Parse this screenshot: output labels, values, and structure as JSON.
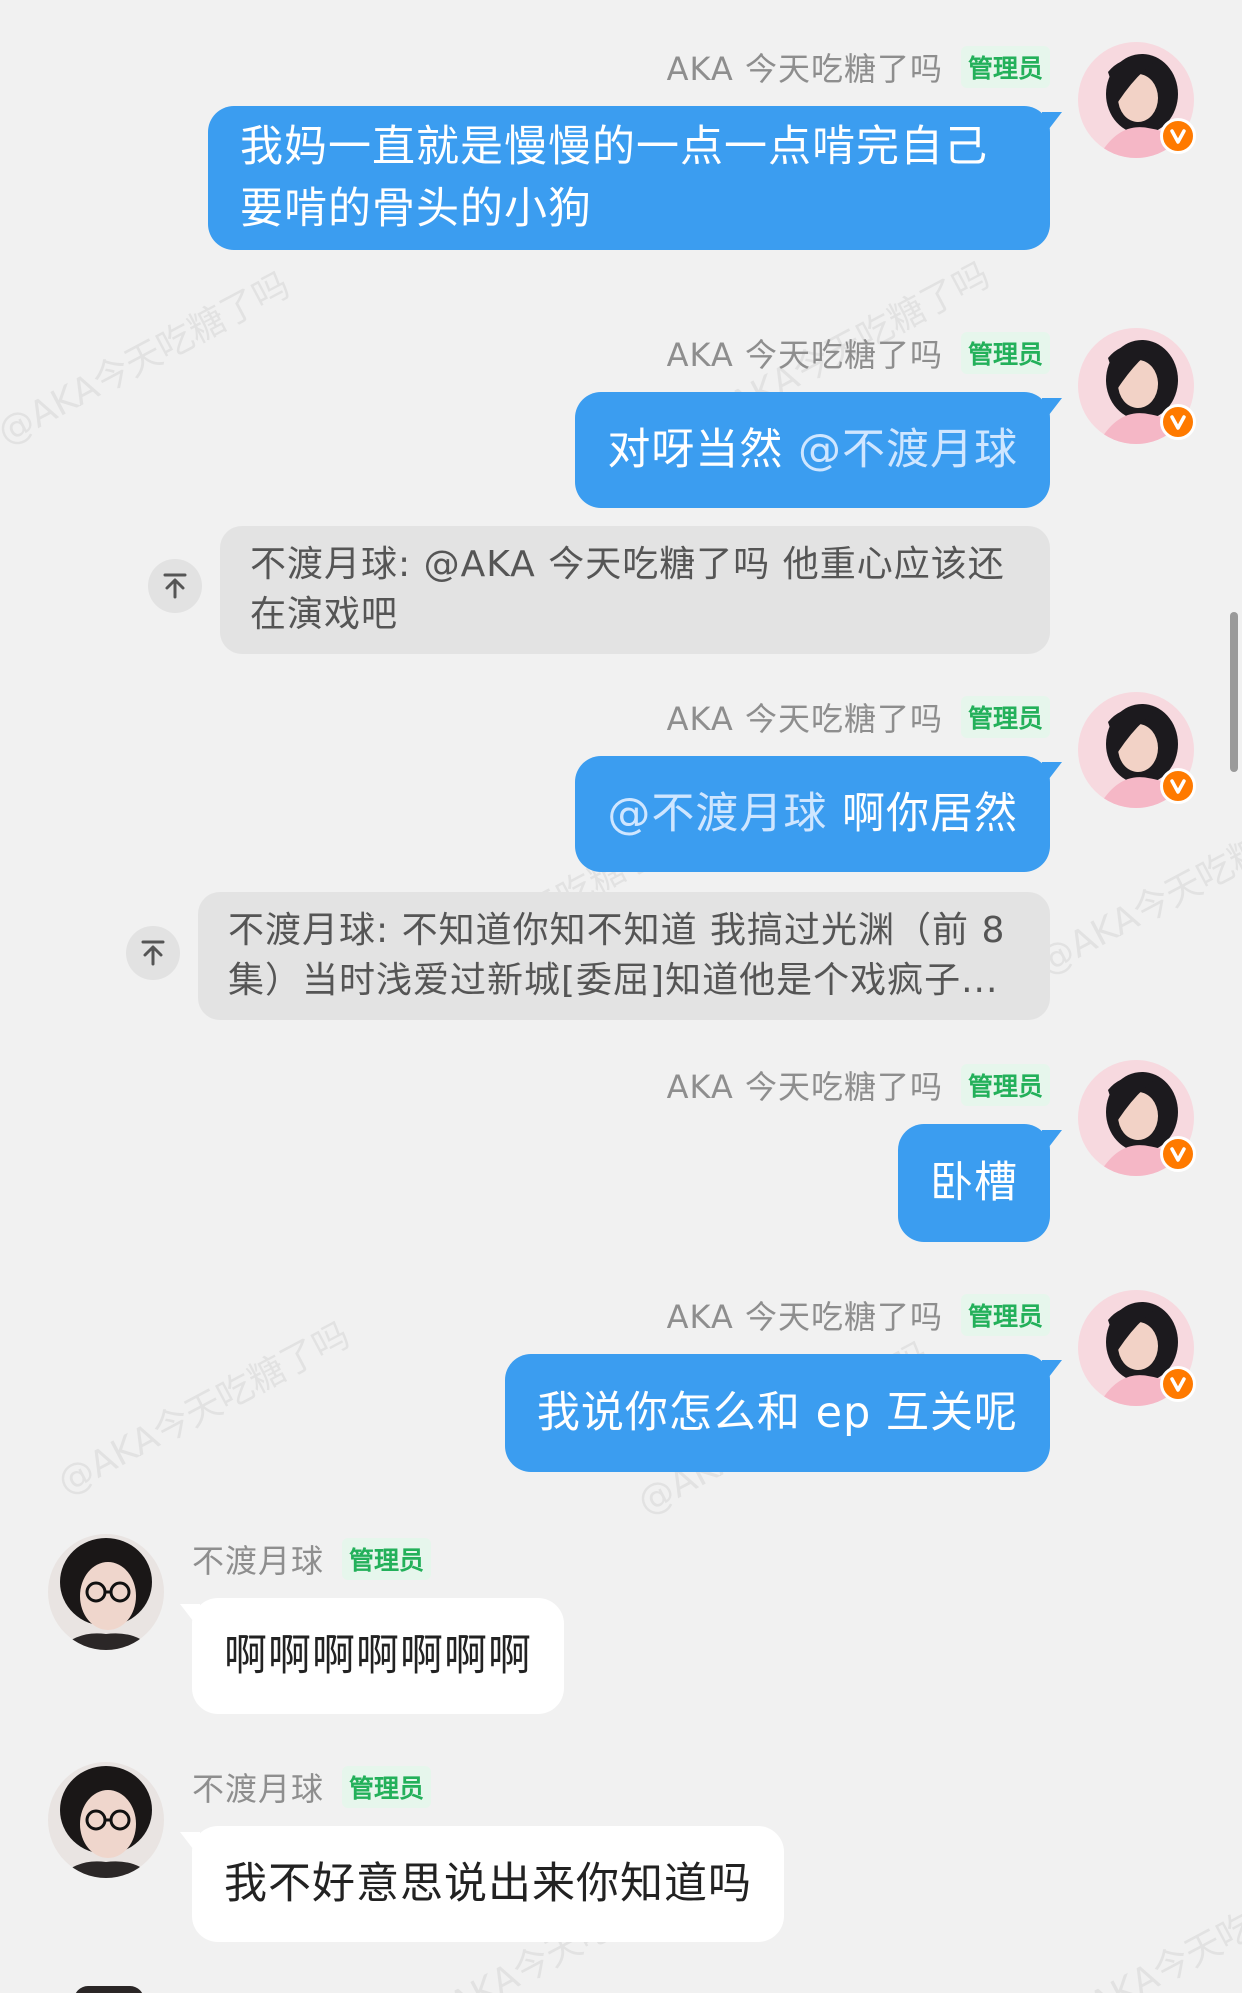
{
  "watermark_text": "@AKA今天吃糖了吗",
  "role_badge": "管理员",
  "messages": [
    {
      "sender": "AKA 今天吃糖了吗",
      "text": "我妈一直就是慢慢的一点一点啃完自己要啃的骨头的小狗"
    },
    {
      "sender": "AKA 今天吃糖了吗",
      "text_before": "对呀当然 ",
      "mention": "@不渡月球",
      "quote": "不渡月球: @AKA 今天吃糖了吗 他重心应该还在演戏吧"
    },
    {
      "sender": "AKA 今天吃糖了吗",
      "mention": "@不渡月球",
      "text_after": " 啊你居然",
      "quote": "不渡月球: 不知道你知不知道 我搞过光渊（前 8 集）当时浅爱过新城[委屈]知道他是个戏疯子..."
    },
    {
      "sender": "AKA 今天吃糖了吗",
      "text": "卧槽"
    },
    {
      "sender": "AKA 今天吃糖了吗",
      "text": "我说你怎么和 ep 互关呢"
    },
    {
      "sender": "不渡月球",
      "text": "啊啊啊啊啊啊啊"
    },
    {
      "sender": "不渡月球",
      "text": "我不好意思说出来你知道吗"
    }
  ],
  "icons": {
    "vip_badge": "v-badge-icon",
    "quote_jump": "arrow-up-to-line-icon"
  },
  "colors": {
    "outgoing_bubble": "#3b9df0",
    "incoming_bubble": "#ffffff",
    "admin_badge_text": "#23b05a",
    "vip_badge": "#ff7a00"
  }
}
